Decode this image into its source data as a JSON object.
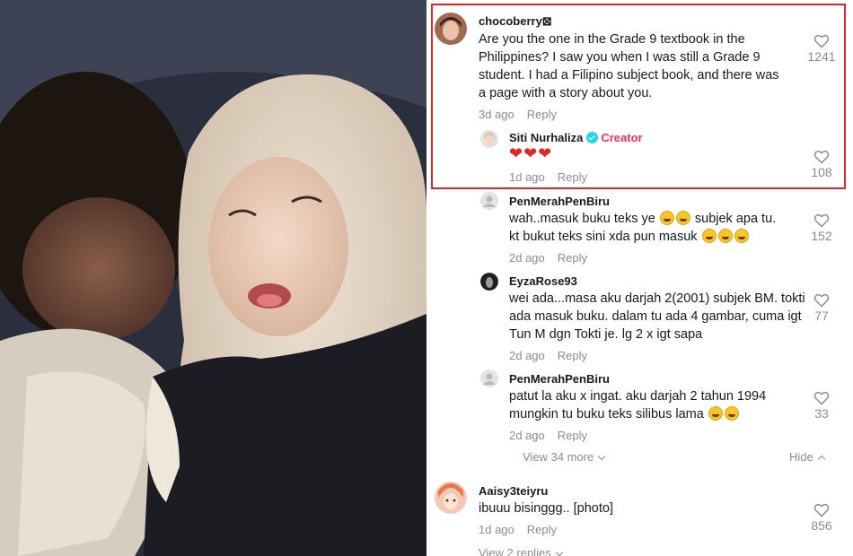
{
  "video": {
    "description_icon": "video-frame"
  },
  "comments": [
    {
      "username": "chocoberry⊠",
      "text": "Are you the one in the Grade 9 textbook in the Philippines? I saw you when I was still a Grade 9 student. I had a Filipino subject book, and there was a page with a story about you.",
      "time": "3d ago",
      "reply_label": "Reply",
      "likes": "1241",
      "highlighted": true
    },
    {
      "username": "Siti Nurhaliza",
      "badge": "Creator",
      "text": "❤❤❤",
      "time": "1d ago",
      "reply_label": "Reply",
      "likes": "108"
    },
    {
      "username": "PenMerahPenBiru",
      "text_line1": "wah..masuk buku teks ye",
      "text_line1b": "subjek apa tu.",
      "text_line2": "kt bukut teks sini xda pun masuk",
      "time": "2d ago",
      "reply_label": "Reply",
      "likes": "152"
    },
    {
      "username": "EyzaRose93",
      "text": "wei ada...masa aku darjah 2(2001) subjek BM. tokti ada masuk buku. dalam tu ada 4 gambar, cuma igt Tun M dgn Tokti je. lg 2 x igt sapa",
      "time": "2d ago",
      "reply_label": "Reply",
      "likes": "77"
    },
    {
      "username": "PenMerahPenBiru",
      "text_line1": "patut la aku x ingat. aku darjah 2 tahun 1994",
      "text_line2": "mungkin tu buku teks silibus lama",
      "time": "2d ago",
      "reply_label": "Reply",
      "likes": "33"
    },
    {
      "username": "Aaisy3teiyru",
      "text": "ibuuu bisinggg.. [photo]",
      "time": "1d ago",
      "reply_label": "Reply",
      "likes": "856"
    }
  ],
  "view_more_label": "View 34 more",
  "hide_label": "Hide",
  "view_replies_label": "View 2 replies",
  "colors": {
    "highlight_border": "#e0252b",
    "creator": "#fe2c55",
    "muted": "#8a8b91"
  }
}
